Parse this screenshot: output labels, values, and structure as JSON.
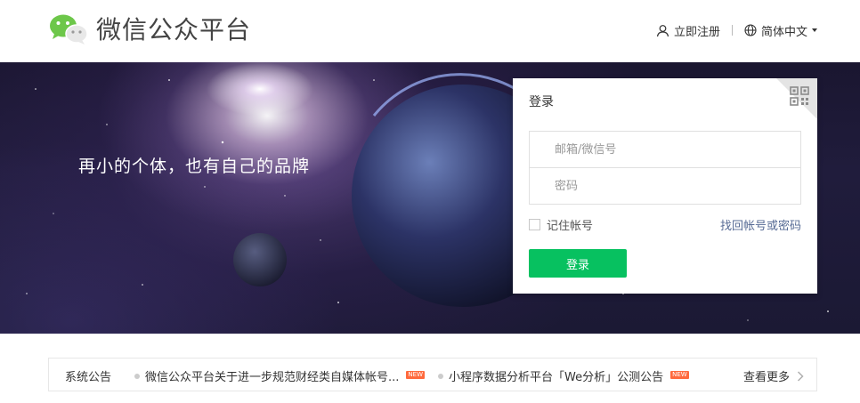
{
  "header": {
    "brand": "微信公众平台",
    "register_label": "立即注册",
    "language_label": "简体中文"
  },
  "banner": {
    "tagline": "再小的个体，也有自己的品牌"
  },
  "login": {
    "title": "登录",
    "account_placeholder": "邮箱/微信号",
    "password_placeholder": "密码",
    "remember_label": "记住帐号",
    "forgot_label": "找回帐号或密码",
    "submit_label": "登录"
  },
  "notice": {
    "label": "系统公告",
    "items": [
      {
        "title": "微信公众平台关于进一步规范财经类自媒体帐号...",
        "badge": "NEW"
      },
      {
        "title": "小程序数据分析平台「We分析」公测公告",
        "badge": "NEW"
      }
    ],
    "more_label": "查看更多"
  },
  "colors": {
    "primary_green": "#07c160",
    "link_blue": "#576b95",
    "badge_orange": "#ff6a3d"
  },
  "icons": [
    "wechat-logo-icon",
    "user-icon",
    "globe-icon",
    "qr-code-icon",
    "chevron-right-icon"
  ]
}
